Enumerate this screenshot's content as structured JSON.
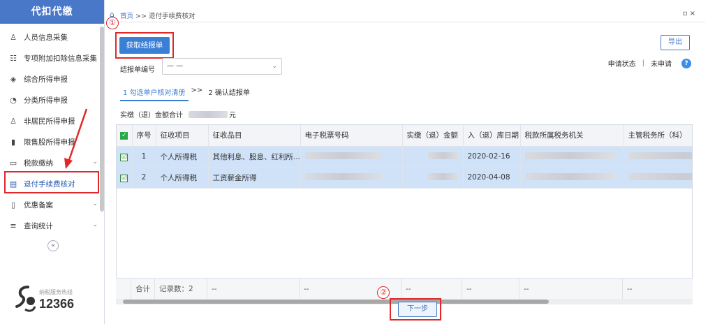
{
  "sidebar": {
    "title": "代扣代缴",
    "items": [
      {
        "label": "人员信息采集",
        "icon": "person-icon",
        "glyph": "♙",
        "chevron": false
      },
      {
        "label": "专项附加扣除信息采集",
        "icon": "grid-icon",
        "glyph": "☷",
        "chevron": false
      },
      {
        "label": "综合所得申报",
        "icon": "layers-icon",
        "glyph": "◈",
        "chevron": false
      },
      {
        "label": "分类所得申报",
        "icon": "pie-chart-icon",
        "glyph": "◔",
        "chevron": false
      },
      {
        "label": "非居民所得申报",
        "icon": "user-outline-icon",
        "glyph": "♙",
        "chevron": false
      },
      {
        "label": "限售股所得申报",
        "icon": "bar-chart-icon",
        "glyph": "▮",
        "chevron": false
      },
      {
        "label": "税款缴纳",
        "icon": "folder-icon",
        "glyph": "▭",
        "chevron": true
      },
      {
        "label": "退付手续费核对",
        "icon": "document-icon",
        "glyph": "▤",
        "chevron": false,
        "active": true
      },
      {
        "label": "优惠备案",
        "icon": "file-icon",
        "glyph": "▯",
        "chevron": true
      },
      {
        "label": "查询统计",
        "icon": "search-list-icon",
        "glyph": "≡",
        "chevron": true
      }
    ],
    "collapse_glyph": "«",
    "hotline_label": "纳税服务热线",
    "hotline_number": "12366"
  },
  "breadcrumb": {
    "home": "首页",
    "sep": ">>",
    "current": "退付手续费核对"
  },
  "window_controls": "▫ ×",
  "toolbar": {
    "fetch_label": "获取结报单",
    "export_label": "导出",
    "annotation_1": "①",
    "annotation_2": "②"
  },
  "status": {
    "label": "申请状态",
    "sep": "|",
    "value": "未申请",
    "help": "?"
  },
  "form": {
    "select_label": "结报单编号",
    "select_value": "— —",
    "select_arrow": "⌄"
  },
  "steps": {
    "step1": "1 勾选单户核对清册",
    "sep": ">>",
    "step2": "2 确认结报单"
  },
  "summary": {
    "label": "实缴（退）金额合计",
    "unit": "元"
  },
  "table": {
    "headers": [
      "序号",
      "征收项目",
      "征收品目",
      "电子税票号码",
      "实缴（退）金额",
      "入（退）库日期",
      "税款所属税务机关",
      "主管税务所（科）"
    ],
    "header_check": "✓",
    "rows": [
      {
        "check": "☑",
        "no": "1",
        "item": "个人所得税",
        "sub": "其他利息、股息、红利所...",
        "date": "2020-02-16"
      },
      {
        "check": "☑",
        "no": "2",
        "item": "个人所得税",
        "sub": "工资薪金所得",
        "date": "2020-04-08"
      }
    ],
    "footer": {
      "label": "合计",
      "count": "记录数：2",
      "dash": "--"
    }
  },
  "next_label": "下一步",
  "colors": {
    "primary": "#3a7fd6",
    "annotation": "#e0282a",
    "selected_row": "#cfe2f8"
  }
}
